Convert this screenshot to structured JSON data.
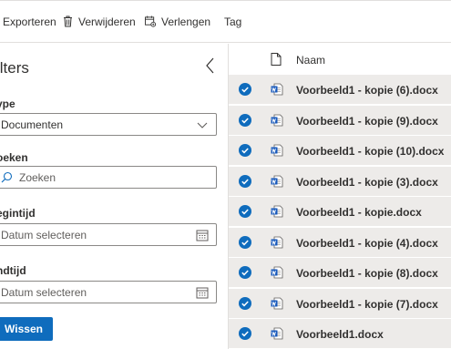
{
  "toolbar": {
    "export_label": "Exporteren",
    "delete_label": "Verwijderen",
    "extend_label": "Verlengen",
    "tag_label": "Tag"
  },
  "filters": {
    "title": "ilters",
    "type_label": "ype",
    "type_value": "Documenten",
    "search_label": "oeken",
    "search_placeholder": "Zoeken",
    "start_label": "egintijd",
    "start_placeholder": "Datum selecteren",
    "end_label": "ndtijd",
    "end_placeholder": "Datum selecteren",
    "clear_label": "Wissen"
  },
  "list": {
    "name_header": "Naam",
    "files": [
      "Voorbeeld1 - kopie (6).docx",
      "Voorbeeld1 - kopie (9).docx",
      "Voorbeeld1 - kopie (10).docx",
      "Voorbeeld1 - kopie (3).docx",
      "Voorbeeld1 - kopie.docx",
      "Voorbeeld1 - kopie (4).docx",
      "Voorbeeld1 - kopie (8).docx",
      "Voorbeeld1 - kopie (7).docx",
      "Voorbeeld1.docx"
    ]
  },
  "colors": {
    "accent": "#0f6cbd",
    "row_selected": "#edebe9",
    "word_blue": "#185abd"
  },
  "icons": {
    "export": "export-icon",
    "delete": "trash-icon",
    "extend": "calendar-extend-icon",
    "collapse": "chevron-left-icon",
    "dropdown": "chevron-down-icon",
    "search": "search-icon",
    "calendar": "calendar-icon",
    "document": "document-icon",
    "checkmark": "checkmark-circle-icon",
    "word": "word-file-icon"
  }
}
